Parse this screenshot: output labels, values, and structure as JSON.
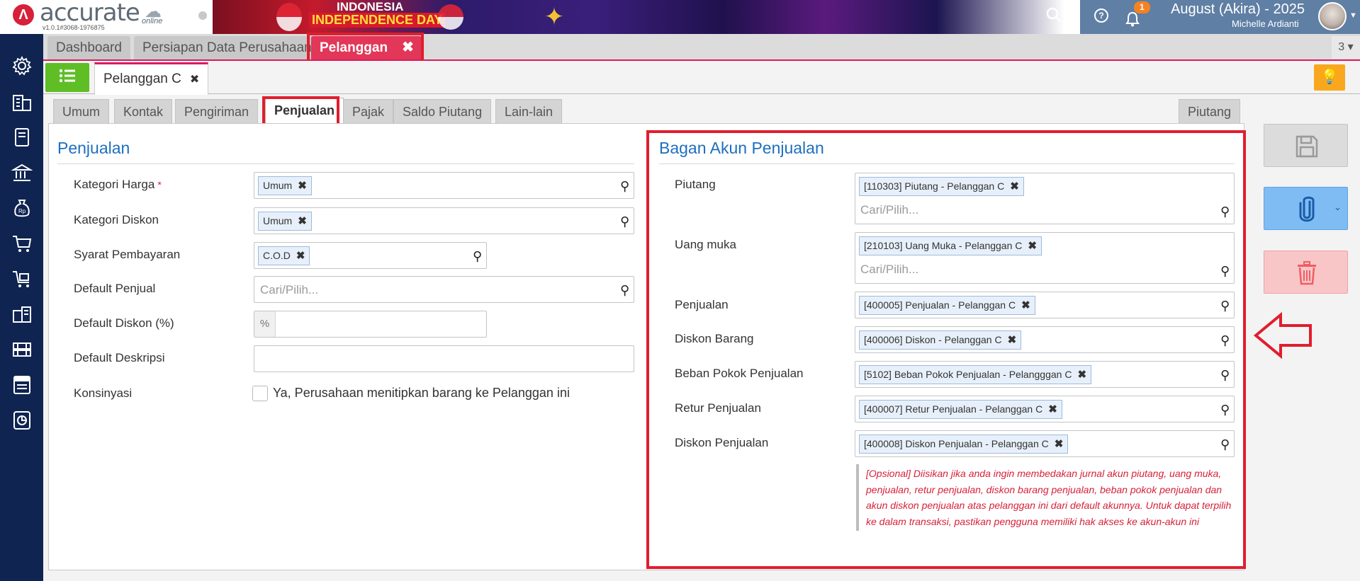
{
  "app": {
    "logo_text": "accurate",
    "logo_sub": "online",
    "version": "v1.0.1#3068-1976875",
    "banner_line1": "INDONESIA",
    "banner_line2": "INDEPENDENCE DAY"
  },
  "user": {
    "period": "August (Akira) - 2025",
    "name": "Michelle Ardianti",
    "notification_count": "1"
  },
  "sidebar": {
    "items": [
      {
        "icon": "gear-icon"
      },
      {
        "icon": "company-building-icon"
      },
      {
        "icon": "ledger-book-icon"
      },
      {
        "icon": "bank-icon"
      },
      {
        "icon": "money-bag-icon"
      },
      {
        "icon": "shopping-cart-icon"
      },
      {
        "icon": "sales-cart-icon"
      },
      {
        "icon": "warehouse-icon"
      },
      {
        "icon": "factory-icon"
      },
      {
        "icon": "tax-icon"
      },
      {
        "icon": "report-chart-icon"
      }
    ]
  },
  "module_tabs": {
    "items": [
      {
        "label": "Dashboard"
      },
      {
        "label": "Persiapan Data Perusahaan"
      },
      {
        "label": "Pelanggan"
      }
    ],
    "count": "3"
  },
  "document": {
    "tab_label": "Pelanggan C"
  },
  "subtabs": {
    "items": [
      {
        "label": "Umum"
      },
      {
        "label": "Kontak"
      },
      {
        "label": "Pengiriman"
      },
      {
        "label": "Penjualan"
      },
      {
        "label": "Pajak"
      },
      {
        "label": "Saldo Piutang"
      },
      {
        "label": "Lain-lain"
      }
    ],
    "right_tab": "Piutang"
  },
  "penjualan": {
    "title": "Penjualan",
    "fields": {
      "kategori_harga": {
        "label": "Kategori Harga",
        "required": "*",
        "value": "Umum"
      },
      "kategori_diskon": {
        "label": "Kategori Diskon",
        "value": "Umum"
      },
      "syarat_pembayaran": {
        "label": "Syarat Pembayaran",
        "value": "C.O.D"
      },
      "default_penjual": {
        "label": "Default Penjual",
        "placeholder": "Cari/Pilih..."
      },
      "default_diskon": {
        "label": "Default Diskon (%)",
        "addon": "%",
        "value": ""
      },
      "default_deskripsi": {
        "label": "Default Deskripsi",
        "value": ""
      },
      "konsinyasi": {
        "label": "Konsinyasi",
        "option": "Ya, Perusahaan menitipkan barang ke Pelanggan ini",
        "checked": false
      }
    }
  },
  "bagan_akun": {
    "title": "Bagan Akun Penjualan",
    "placeholder": "Cari/Pilih...",
    "fields": {
      "piutang": {
        "label": "Piutang",
        "value": "[110303] Piutang - Pelanggan C"
      },
      "uang_muka": {
        "label": "Uang muka",
        "value": "[210103] Uang Muka - Pelanggan C"
      },
      "penjualan": {
        "label": "Penjualan",
        "value": "[400005] Penjualan - Pelanggan C"
      },
      "diskon_barang": {
        "label": "Diskon Barang",
        "value": "[400006] Diskon - Pelanggan C"
      },
      "beban_pokok": {
        "label": "Beban Pokok Penjualan",
        "value": "[5102] Beban Pokok Penjualan - Pelangggan C"
      },
      "retur_penjualan": {
        "label": "Retur Penjualan",
        "value": "[400007] Retur Penjualan - Pelanggan C"
      },
      "diskon_penjualan": {
        "label": "Diskon Penjualan",
        "value": "[400008] Diskon Penjualan - Pelanggan C"
      }
    },
    "note": "[Opsional] Diisikan jika anda ingin membedakan jurnal akun piutang, uang muka, penjualan, retur penjualan, diskon barang penjualan, beban pokok penjualan dan akun diskon penjualan atas pelanggan ini dari default akunnya. Untuk dapat terpilih ke dalam transaksi, pastikan pengguna memiliki hak akses ke akun-akun ini"
  },
  "colors": {
    "sidebar": "#0f2451",
    "accent": "#d81b60",
    "title_blue": "#1d6fbf",
    "highlight_red": "#e01e2e"
  }
}
